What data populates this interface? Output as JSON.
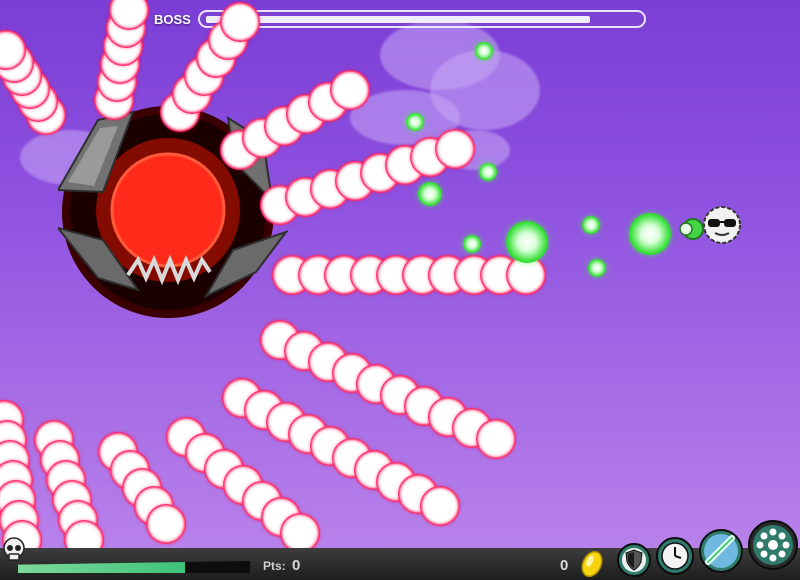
{
  "boss": {
    "label": "BOSS",
    "health_fraction": 0.88,
    "colors": {
      "core": "#ff2b1a",
      "shell": "#6b6b6b",
      "inner": "#1a0000"
    }
  },
  "player": {
    "icon": "sunglasses-face-icon",
    "health_fraction": 0.72
  },
  "hud": {
    "points_label": "Pts:",
    "points_value": "0",
    "coins_value": "0",
    "status_icon": "skull-icon",
    "coin_icon": "yellow-gem-icon",
    "powerups": [
      {
        "name": "shield-powerup-button",
        "icon": "shield-icon"
      },
      {
        "name": "slow-time-powerup-button",
        "icon": "clock-icon"
      },
      {
        "name": "laser-powerup-button",
        "icon": "laser-icon"
      },
      {
        "name": "spread-shot-powerup-button",
        "icon": "orb-spread-icon"
      }
    ]
  },
  "colors": {
    "background_top": "#7a3ed6",
    "background_bottom": "#bb86ec",
    "enemy_bullet": "#ff2d6b",
    "player_bullet": "#38e038"
  }
}
